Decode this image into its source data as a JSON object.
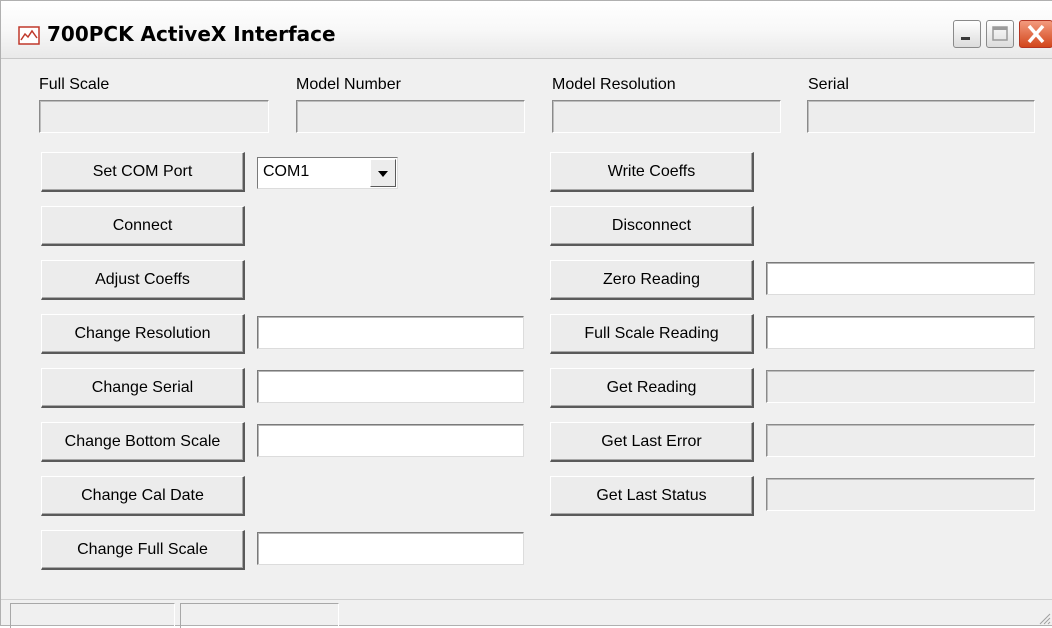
{
  "window": {
    "title": "700PCK ActiveX Interface"
  },
  "icons": {
    "app": "chart-window-icon",
    "minimize": "minimize-icon",
    "maximize": "maximize-icon",
    "close": "close-icon"
  },
  "colors": {
    "close_button": "#d2461b",
    "face": "#ececec"
  },
  "info": {
    "full_scale_label": "Full Scale",
    "model_number_label": "Model Number",
    "model_resolution_label": "Model Resolution",
    "serial_label": "Serial",
    "full_scale_value": "",
    "model_number_value": "",
    "model_resolution_value": "",
    "serial_value": ""
  },
  "left_buttons": {
    "set_com_port": "Set COM Port",
    "connect": "Connect",
    "adjust_coeffs": "Adjust Coeffs",
    "change_resolution": "Change Resolution",
    "change_serial": "Change Serial",
    "change_bottom_scale": "Change Bottom Scale",
    "change_cal_date": "Change Cal Date",
    "change_full_scale": "Change Full Scale"
  },
  "com_port": {
    "selected": "COM1"
  },
  "left_inputs": {
    "resolution": "",
    "serial": "",
    "bottom_scale": "",
    "full_scale": ""
  },
  "right_buttons": {
    "write_coeffs": "Write Coeffs",
    "disconnect": "Disconnect",
    "zero_reading": "Zero Reading",
    "full_scale_reading": "Full Scale Reading",
    "get_reading": "Get Reading",
    "get_last_error": "Get Last Error",
    "get_last_status": "Get Last Status"
  },
  "right_fields": {
    "zero_reading": "",
    "full_scale_reading": "",
    "reading": "",
    "last_error": "",
    "last_status": ""
  },
  "status_bar": {
    "pane1": "",
    "pane2": ""
  }
}
